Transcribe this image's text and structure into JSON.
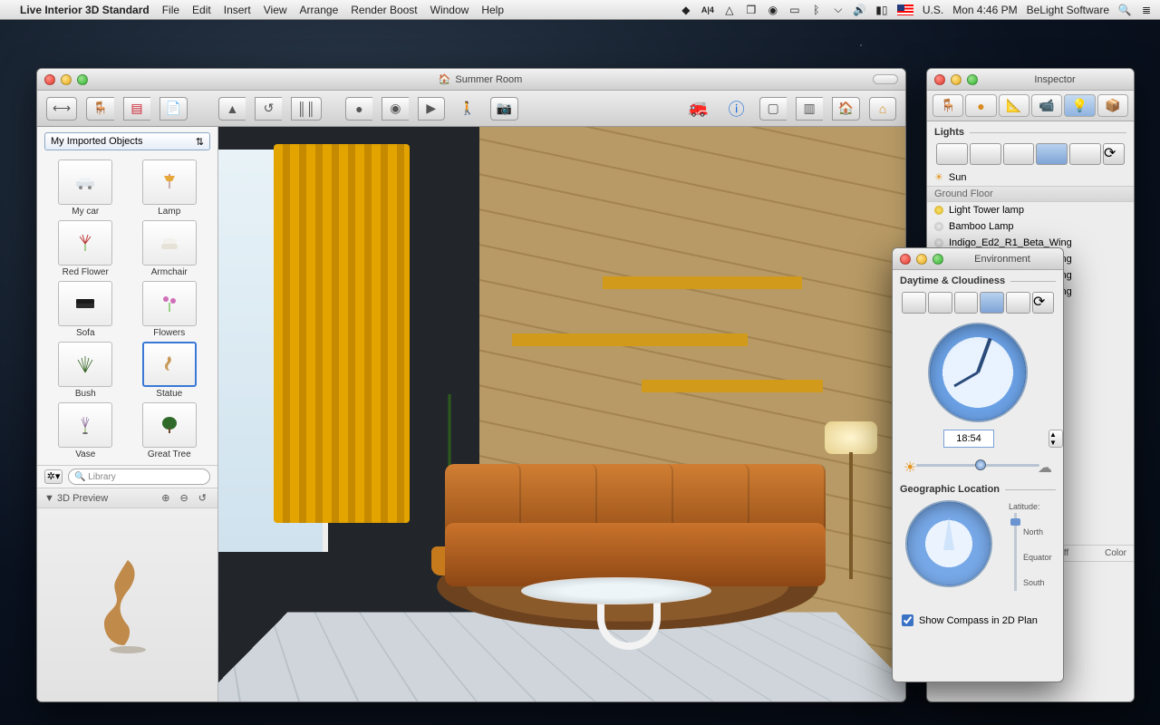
{
  "menubar": {
    "app": "Live Interior 3D Standard",
    "items": [
      "File",
      "Edit",
      "Insert",
      "View",
      "Arrange",
      "Render Boost",
      "Window",
      "Help"
    ],
    "locale": "U.S.",
    "clock": "Mon 4:46 PM",
    "vendor": "BeLight Software"
  },
  "main": {
    "title": "Summer Room",
    "library_select": "My Imported Objects",
    "objects": [
      {
        "label": "My car"
      },
      {
        "label": "Lamp"
      },
      {
        "label": "Red Flower"
      },
      {
        "label": "Armchair"
      },
      {
        "label": "Sofa"
      },
      {
        "label": "Flowers"
      },
      {
        "label": "Bush"
      },
      {
        "label": "Statue"
      },
      {
        "label": "Vase"
      },
      {
        "label": "Great Tree"
      }
    ],
    "selected_object_index": 7,
    "search_placeholder": "Library",
    "preview_label": "3D Preview"
  },
  "inspector": {
    "title": "Inspector",
    "section": "Lights",
    "sun_label": "Sun",
    "floor_label": "Ground Floor",
    "lights": [
      {
        "name": "Light Tower lamp",
        "on": true
      },
      {
        "name": "Bamboo Lamp",
        "on": false
      },
      {
        "name": "Indigo_Ed2_R1_Beta_Wing",
        "on": false
      },
      {
        "name": "Indigo_Ed2_R1_Beta_Wing",
        "on": false
      },
      {
        "name": "Indigo_Ed2_R1_Beta_Wing",
        "on": false
      },
      {
        "name": "Indigo_Ed2_R1_Beta_Wing",
        "on": false
      }
    ],
    "col_onoff": "On|Off",
    "col_color": "Color"
  },
  "environment": {
    "title": "Environment",
    "section_day": "Daytime & Cloudiness",
    "time_value": "18:54",
    "section_geo": "Geographic Location",
    "lat_label": "Latitude:",
    "lat_ticks": [
      "North",
      "Equator",
      "South"
    ],
    "compass_checkbox": "Show Compass in 2D Plan"
  }
}
